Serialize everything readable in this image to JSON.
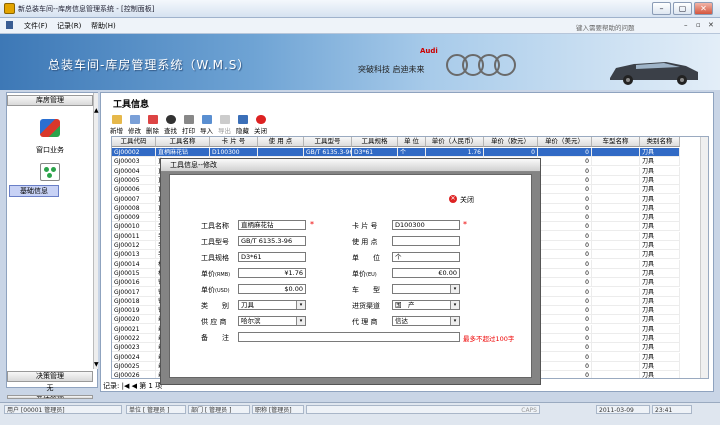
{
  "window": {
    "title": "新总装车间--库房信息管理系统 - [控制面板]",
    "min_glyph": "–",
    "max_glyph": "▢",
    "close_glyph": "✕"
  },
  "menu": {
    "items": [
      "文件(F)",
      "记录(R)",
      "帮助(H)"
    ],
    "help_placeholder": "键入需要帮助的问题",
    "win_ctl": [
      "–",
      "▫",
      "✕"
    ]
  },
  "banner": {
    "system_name": "总装车间-库房管理系统（W.M.S）",
    "brand": "Audi",
    "slogan": "突破科技 启迪未来"
  },
  "sidebar": {
    "section1": "库房管理",
    "items": [
      "窗口业务",
      "基础信息"
    ],
    "section2": "决策管理",
    "item3": "无",
    "section3": "系统管理",
    "up_glyph": "▲",
    "down_glyph": "▼"
  },
  "page": {
    "title": "工具信息",
    "toolbar": [
      "新增",
      "修改",
      "删除",
      "查找",
      "打印",
      "导入",
      "导出",
      "隐藏",
      "关闭"
    ]
  },
  "grid": {
    "columns": [
      "工具代码",
      "工具名称",
      "卡 片 号",
      "使 用 点",
      "工具型号",
      "工具规格",
      "单 位",
      "单价（人民币）",
      "单价（欧元）",
      "单价（美元）",
      "车型名称",
      "类别名称"
    ],
    "codes": [
      "GJ00002",
      "GJ00003",
      "GJ00004",
      "GJ00005",
      "GJ00006",
      "GJ00007",
      "GJ00008",
      "GJ00009",
      "GJ00010",
      "GJ00011",
      "GJ00012",
      "GJ00013",
      "GJ00014",
      "GJ00015",
      "GJ00016",
      "GJ00017",
      "GJ00018",
      "GJ00019",
      "GJ00020",
      "GJ00021",
      "GJ00022",
      "GJ00023",
      "GJ00024",
      "GJ00025",
      "GJ00026"
    ],
    "names": [
      "直柄麻花钻",
      "直",
      "直",
      "直",
      "直",
      "直",
      "直",
      "手",
      "手",
      "手",
      "手",
      "手",
      "机",
      "机",
      "钢",
      "钢",
      "钢",
      "钢",
      "丝",
      "丝",
      "丝",
      "丝",
      "丝",
      "丝",
      "丝"
    ],
    "first_row": {
      "card": "D100300",
      "model": "GB/T 6135.3-96",
      "spec": "D3*61",
      "unit": "个",
      "rmb": "1.76",
      "eur": "0",
      "usd": "0",
      "type": "刀具"
    },
    "zero": "0",
    "type_name": "刀具",
    "partial_value": "98.32",
    "record_label": "记录: ",
    "record_first": "|◀",
    "record_prev": "◀",
    "record_current": "第 1 项"
  },
  "dialog": {
    "title": "工具信息--修改",
    "close_label": "关闭",
    "close_glyph": "✕",
    "labels": {
      "name": "工具名称",
      "card": "卡 片 号",
      "model": "工具型号",
      "point": "使 用 点",
      "spec": "工具规格",
      "unit": "单　　位",
      "price_rmb": "单价",
      "rmb_tag": "(RMB)",
      "price_eur": "单价",
      "eur_tag": "(EU)",
      "price_usd": "单价",
      "usd_tag": "(USD)",
      "car_type": "车　　型",
      "category": "类　　别",
      "channel": "进货渠道",
      "supplier": "供 应 商",
      "agent": "代 理 商",
      "remark": "备　　注"
    },
    "values": {
      "name": "直柄麻花钻",
      "card": "D100300",
      "model": "GB/T 6135.3-96",
      "point": "",
      "spec": "D3*61",
      "unit": "个",
      "price_rmb": "¥1.76",
      "price_eur": "€0.00",
      "price_usd": "$0.00",
      "car_type": "",
      "category": "刀具",
      "channel": "国　产",
      "supplier": "哈尔滨",
      "agent": "信达",
      "remark": ""
    },
    "required_mark": "*",
    "dd_glyph": "▾",
    "remark_hint": "最多不超过100字"
  },
  "statusbar": {
    "cells": [
      "用户 [00001 管理员]",
      "单位 [ 管理员 ]",
      "部门 [ 管理员 ]",
      "职称 [管理员]",
      "CAPS",
      "2011-03-09",
      "23:41"
    ]
  },
  "colors": {
    "accent": "#3d78b6",
    "selected_row": "#316ac5",
    "warning": "#e00000"
  }
}
